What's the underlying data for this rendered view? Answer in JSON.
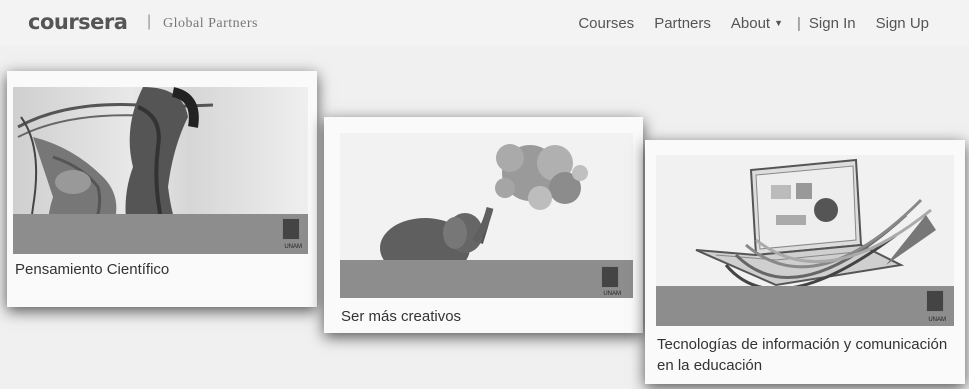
{
  "header": {
    "logo": "coursera",
    "separator": "|",
    "subtitle": "Global Partners",
    "nav": {
      "courses": "Courses",
      "partners": "Partners",
      "about": "About",
      "divider": "|",
      "sign_in": "Sign In",
      "sign_up": "Sign Up"
    }
  },
  "cards": [
    {
      "title": "Pensamiento Científico",
      "partner_label": "UNAM"
    },
    {
      "title": "Ser más creativos",
      "partner_label": "UNAM"
    },
    {
      "title": "Tecnologías de información y comunicación en la educación",
      "partner_label": "UNAM"
    }
  ],
  "colors": {
    "background": "#f0f0f0",
    "card": "#fafafa",
    "band": "#8d8d8d",
    "text": "#333333"
  }
}
